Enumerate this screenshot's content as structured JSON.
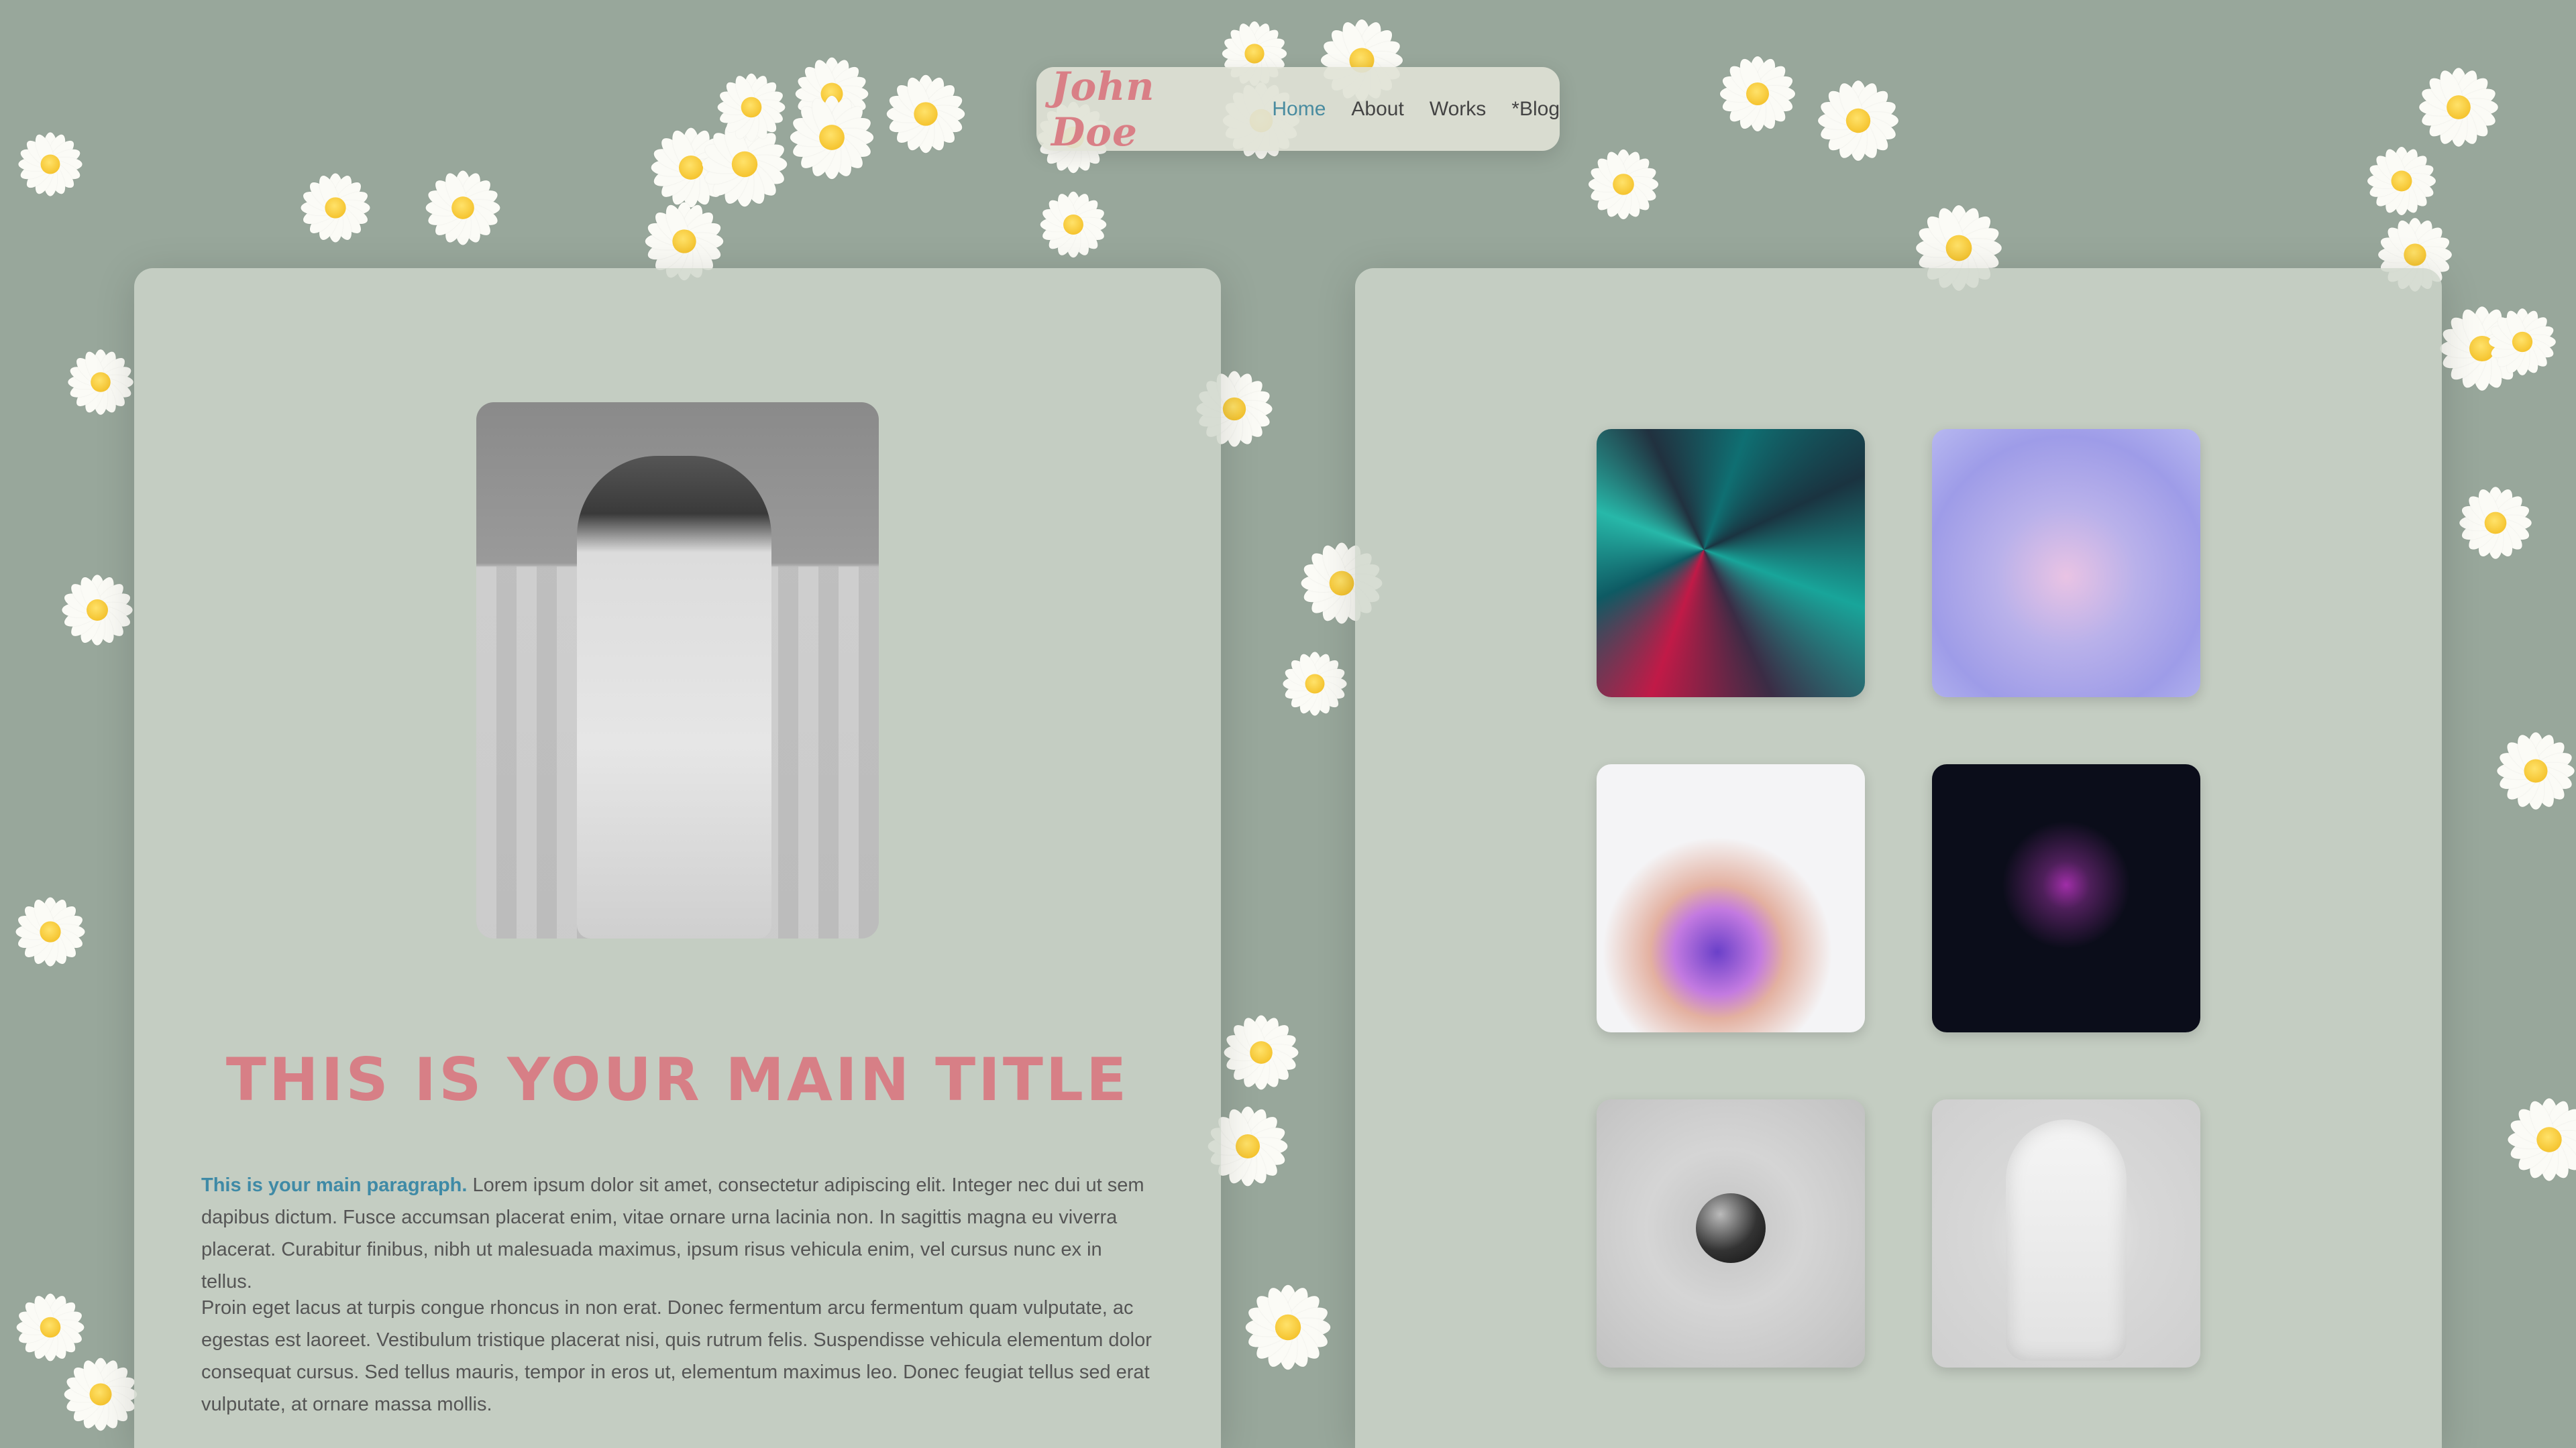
{
  "site": {
    "logo": "John Doe",
    "nav": [
      {
        "label": "Home",
        "active": true
      },
      {
        "label": "About",
        "active": false
      },
      {
        "label": "Works",
        "active": false
      },
      {
        "label": "*Blog",
        "active": false
      }
    ]
  },
  "hero": {
    "title": "THIS IS YOUR MAIN TITLE",
    "paragraph1_lead": "This is your main paragraph.",
    "paragraph1_body": " Lorem ipsum dolor sit amet, consectetur adipiscing elit. Integer nec dui ut sem dapibus dictum. Fusce accumsan placerat enim, vitae ornare urna lacinia non. In sagittis magna eu viverra placerat. Curabitur finibus, nibh ut malesuada maximus, ipsum risus vehicula enim, vel cursus nunc ex in tellus.",
    "paragraph2": "Proin eget lacus at turpis congue rhoncus in non erat. Donec fermentum arcu fermentum quam vulputate, ac egestas est laoreet. Vestibulum tristique placerat nisi, quis rutrum felis. Suspendisse vehicula elementum dolor consequat cursus. Sed tellus mauris, tempor in eros ut, elementum maximus leo. Donec feugiat tellus sed erat vulputate, at ornare massa mollis."
  },
  "colors": {
    "background": "#98a79b",
    "accent_pink": "#d77f86",
    "accent_blue": "#3f8aa6"
  },
  "gallery": [
    {
      "name": "teal-crystal-art"
    },
    {
      "name": "lavender-swirl-art"
    },
    {
      "name": "liquid-splash-art"
    },
    {
      "name": "purple-coat-figure"
    },
    {
      "name": "metal-sphere"
    },
    {
      "name": "cracked-bust-statue"
    }
  ]
}
